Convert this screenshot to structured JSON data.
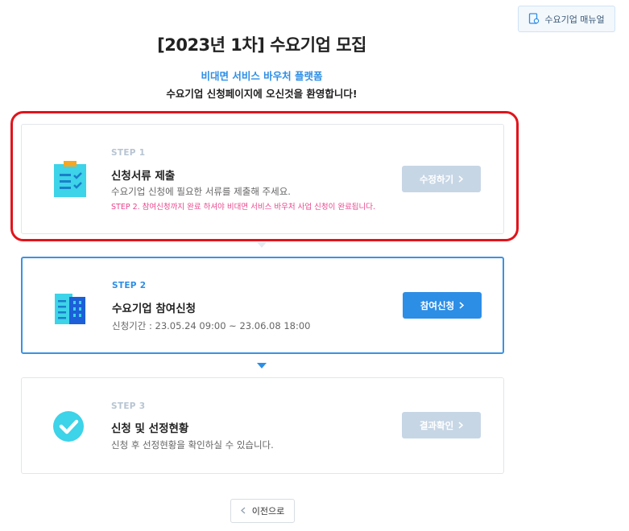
{
  "header": {
    "manual_button_label": "수요기업 매뉴얼",
    "page_title": "[2023년 1차] 수요기업 모집",
    "sub_title": "비대면 서비스 바우처 플랫폼",
    "welcome_text": "수요기업 신청페이지에 오신것을 환영합니다!"
  },
  "steps": [
    {
      "step_label": "STEP 1",
      "title": "신청서류 제출",
      "description": "수요기업 신청에 필요한 서류를 제출해 주세요.",
      "note": "STEP 2. 참여신청까지 완료 하셔야 비대면 서비스 바우처 사업 신청이 완료됩니다.",
      "button_label": "수정하기",
      "button_icon": "chevron-right-icon",
      "icon": "clipboard-checklist-icon",
      "state": "completed"
    },
    {
      "step_label": "STEP 2",
      "title": "수요기업 참여신청",
      "description": "신청기간 : 23.05.24 09:00 ~ 23.06.08 18:00",
      "button_label": "참여신청",
      "button_icon": "chevron-right-icon",
      "icon": "building-icon",
      "state": "active"
    },
    {
      "step_label": "STEP 3",
      "title": "신청 및 선정현황",
      "description": "신청 후 선정현황을 확인하실 수 있습니다.",
      "button_label": "결과확인",
      "button_icon": "chevron-right-icon",
      "icon": "check-circle-icon",
      "state": "disabled"
    }
  ],
  "footer": {
    "back_button_label": "이전으로",
    "back_button_icon": "chevron-left-icon"
  },
  "colors": {
    "accent": "#2d8ee6",
    "highlight_ring": "#e3131a",
    "note": "#e8468d",
    "disabled_button": "#c7d6e5",
    "icon_teal": "#3dd3e8"
  }
}
